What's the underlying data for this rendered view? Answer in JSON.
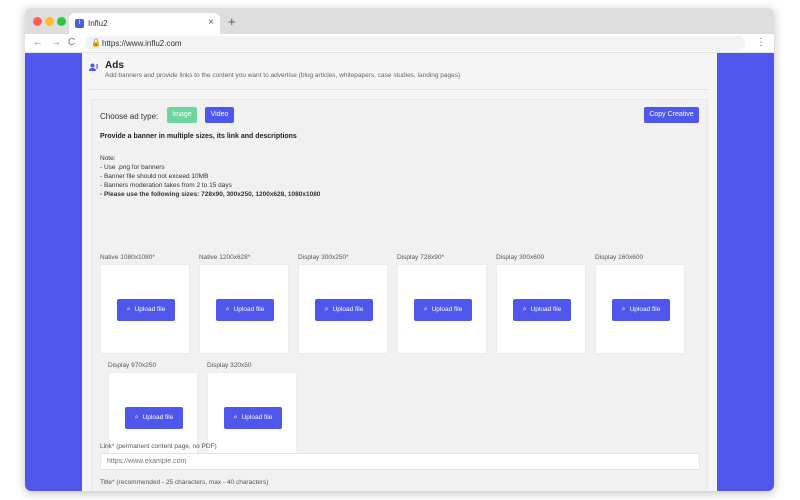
{
  "browser": {
    "tab_title": "Influ2",
    "tab_favicon": "I",
    "tab_close": "×",
    "new_tab": "+",
    "url": "https://www.influ2.com",
    "back": "←",
    "forward": "→",
    "reload": "C",
    "menu": "⋮",
    "lock": "🔒"
  },
  "header": {
    "title": "Ads",
    "subtitle": "Add banners and provide links to the content you want to advertise (blog articles, whitepapers, case studies, landing pages)"
  },
  "ad_type": {
    "label": "Choose ad type:",
    "image_label": "Image",
    "video_label": "Video",
    "copy_label": "Copy Creative"
  },
  "instructions": {
    "provide": "Provide a banner in multiple sizes, its link and descriptions",
    "note_title": "Note:",
    "note_1": "- Use .png for banners",
    "note_2": "- Banner file should not exceed 10MB",
    "note_3": "- Banners moderation takes from 2 to 15 days",
    "note_4": "- Please use the following sizes: 728x90, 300x250, 1200x628, 1080x1080"
  },
  "slots": [
    {
      "label": "Native 1080x1080*",
      "button": "Upload file"
    },
    {
      "label": "Native 1200x628*",
      "button": "Upload file"
    },
    {
      "label": "Display 300x250*",
      "button": "Upload file"
    },
    {
      "label": "Display 728x90*",
      "button": "Upload file"
    },
    {
      "label": "Display 300x600",
      "button": "Upload file"
    },
    {
      "label": "Display 160x600",
      "button": "Upload file"
    },
    {
      "label": "Display 970x250",
      "button": "Upload file"
    },
    {
      "label": "Display 320x50",
      "button": "Upload file"
    }
  ],
  "form": {
    "link_label": "Link* (permanent content page, no PDF)",
    "link_placeholder": "https://www.example.com",
    "title_label": "Title* (recommended - 25 characters, max - 40 characters)"
  },
  "colors": {
    "accent": "#4f56ec",
    "image_button": "#6dd5a0"
  }
}
